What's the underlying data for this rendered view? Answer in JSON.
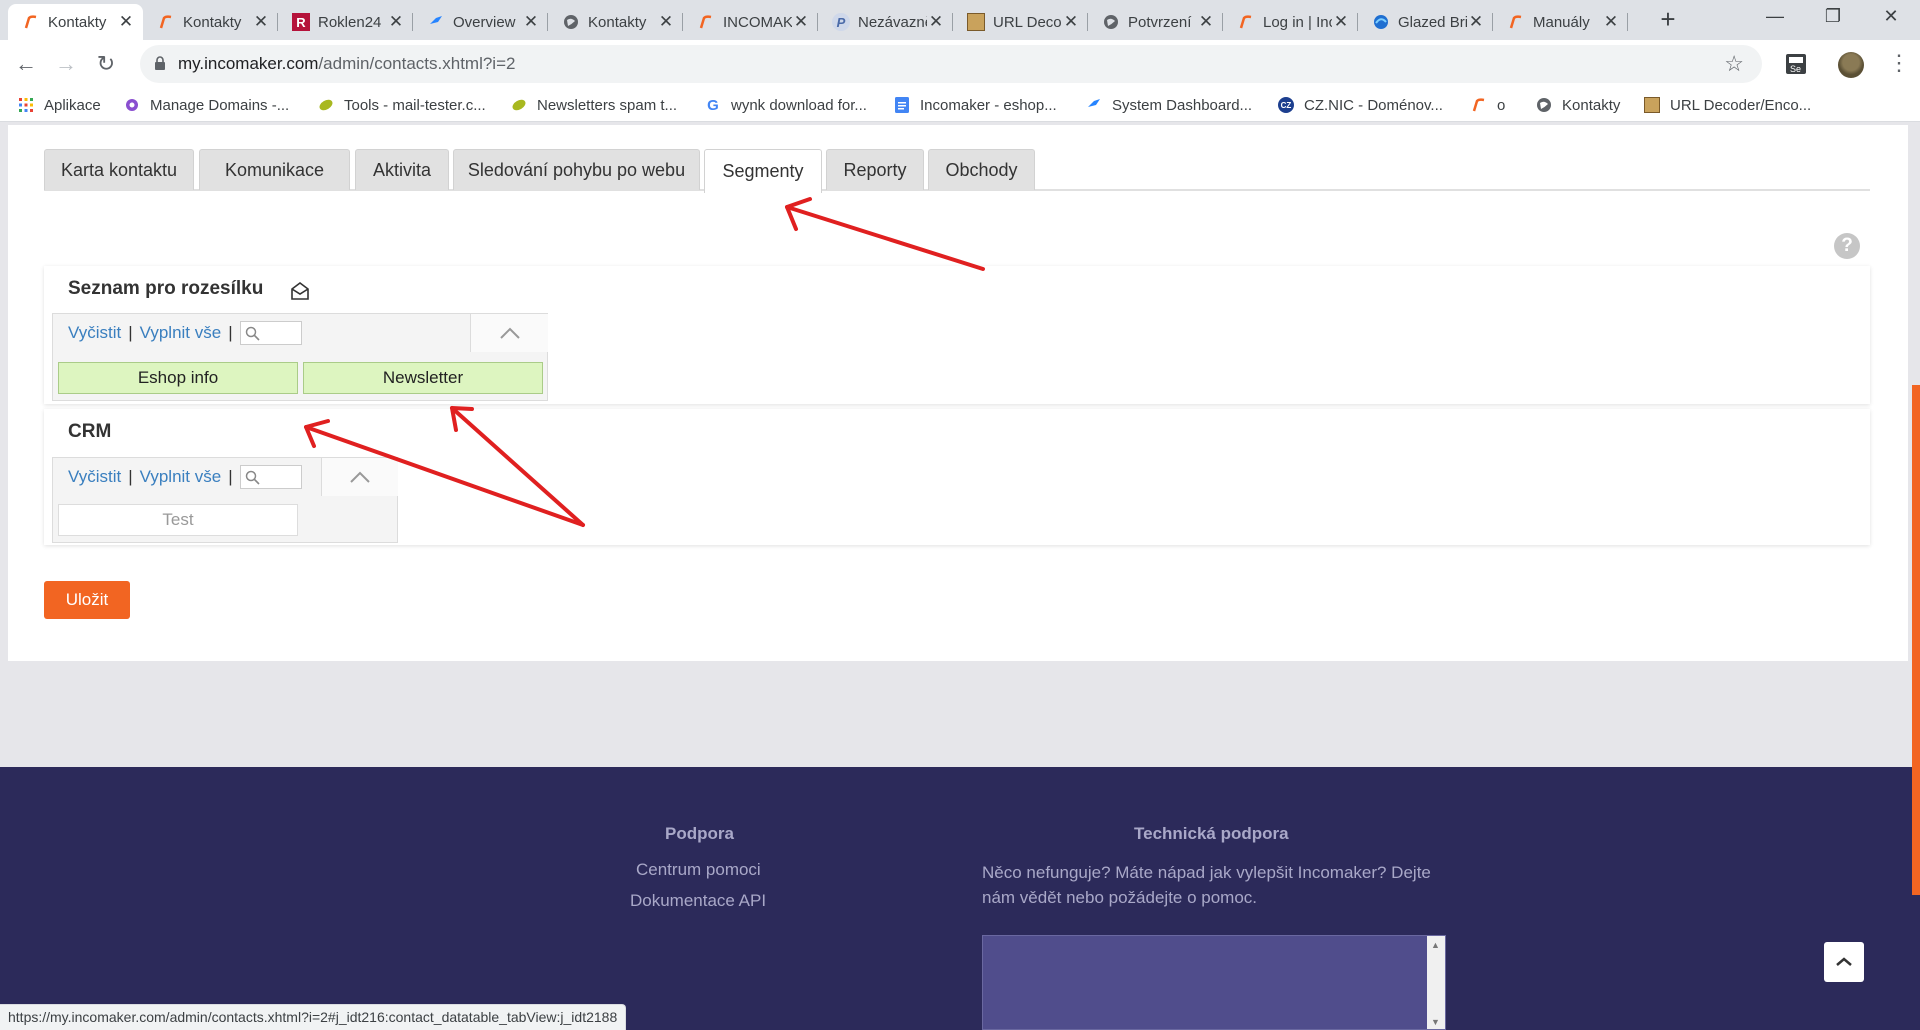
{
  "browser": {
    "tabs": [
      {
        "title": "Kontakty",
        "icon": "incomaker-icon",
        "active": true
      },
      {
        "title": "Kontakty",
        "icon": "incomaker-icon"
      },
      {
        "title": "Roklen24",
        "icon": "roklen-icon"
      },
      {
        "title": "Overview",
        "icon": "jira-icon"
      },
      {
        "title": "Kontakty",
        "icon": "globe-icon"
      },
      {
        "title": "INCOMAKER",
        "icon": "incomaker-icon"
      },
      {
        "title": "Nezávazně",
        "icon": "p-icon"
      },
      {
        "title": "URL Decoder",
        "icon": "url-decoder-icon"
      },
      {
        "title": "Potvrzení",
        "icon": "globe-icon"
      },
      {
        "title": "Log in | Incomaker",
        "icon": "incomaker-icon"
      },
      {
        "title": "Glazed Bricks",
        "icon": "edge-icon"
      },
      {
        "title": "Manuály",
        "icon": "incomaker-icon"
      }
    ],
    "url_host": "my.incomaker.com",
    "url_path": "/admin/contacts.xhtml?i=2",
    "bookmarks": [
      {
        "label": "Aplikace",
        "icon": "apps-grid-icon"
      },
      {
        "label": "Manage Domains -...",
        "icon": "bookmark-icon"
      },
      {
        "label": "Tools - mail-tester.c...",
        "icon": "leaf-icon"
      },
      {
        "label": "Newsletters spam t...",
        "icon": "leaf-icon"
      },
      {
        "label": "wynk download for...",
        "icon": "google-icon"
      },
      {
        "label": "Incomaker - eshop...",
        "icon": "docs-icon"
      },
      {
        "label": "System Dashboard...",
        "icon": "jira-icon"
      },
      {
        "label": "CZ.NIC - Doménov...",
        "icon": "cznic-icon"
      },
      {
        "label": "o",
        "icon": "incomaker-icon"
      },
      {
        "label": "Kontakty",
        "icon": "globe-icon"
      },
      {
        "label": "URL Decoder/Enco...",
        "icon": "url-decoder-icon"
      }
    ],
    "status_url": "https://my.incomaker.com/admin/contacts.xhtml?i=2#j_idt216:contact_datatable_tabView:j_idt2188"
  },
  "page": {
    "tabs": [
      "Karta kontaktu",
      "Komunikace",
      "Aktivita",
      "Sledování pohybu po webu",
      "Segmenty",
      "Reporty",
      "Obchody"
    ],
    "active_tab": "Segmenty",
    "help_label": "?",
    "mailing": {
      "title": "Seznam pro rozesílku",
      "clear": "Vyčistit",
      "sep": "|",
      "fill_all": "Vyplnit vše",
      "chips": [
        "Eshop info",
        "Newsletter"
      ]
    },
    "crm": {
      "title": "CRM",
      "clear": "Vyčistit",
      "sep": "|",
      "fill_all": "Vyplnit vše",
      "chips": [
        "Test"
      ]
    },
    "save_label": "Uložit"
  },
  "footer": {
    "support_title": "Podpora",
    "support_links": [
      "Centrum pomoci",
      "Dokumentace API"
    ],
    "tech_title": "Technická podpora",
    "tech_text": "Něco nefunguje? Máte nápad jak vylepšit Incomaker? Dejte nám vědět nebo požádejte o pomoc."
  },
  "colors": {
    "accent": "#f26522",
    "footer_bg": "#2c2a5a",
    "chip_selected": "#ddf5c0",
    "link": "#3a7fbf",
    "annotation_arrow": "#e02020"
  }
}
